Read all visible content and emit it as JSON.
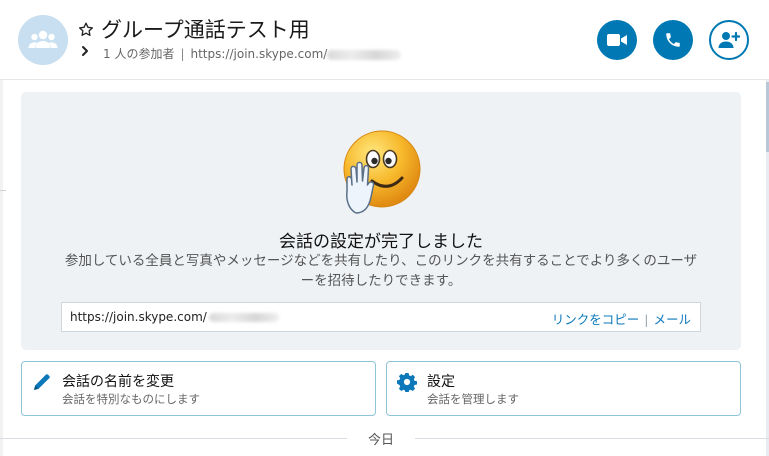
{
  "header": {
    "title": "グループ通話テスト用",
    "participants": "1 人の参加者",
    "separator": "|",
    "link_prefix": "https://join.skype.com/"
  },
  "header_buttons": {
    "video_icon": "video-camera-icon",
    "call_icon": "phone-icon",
    "add_icon": "add-person-icon"
  },
  "panel": {
    "title": "会話の設定が完了しました",
    "description": "参加している全員と写真やメッセージなどを共有したり、このリンクを共有することでより多くのユーザーを招待したりできます。",
    "link_prefix": "https://join.skype.com/",
    "copy_link": "リンクをコピー",
    "action_separator": "|",
    "mail": "メール"
  },
  "cards": {
    "rename": {
      "title": "会話の名前を変更",
      "subtitle": "会話を特別なものにします"
    },
    "settings": {
      "title": "設定",
      "subtitle": "会話を管理します"
    }
  },
  "divider": {
    "label": "今日"
  },
  "colors": {
    "accent": "#0078b4",
    "panel_bg": "#eff2f5",
    "card_border": "#8fc4d9",
    "avatar_bg": "#c7dff0"
  }
}
